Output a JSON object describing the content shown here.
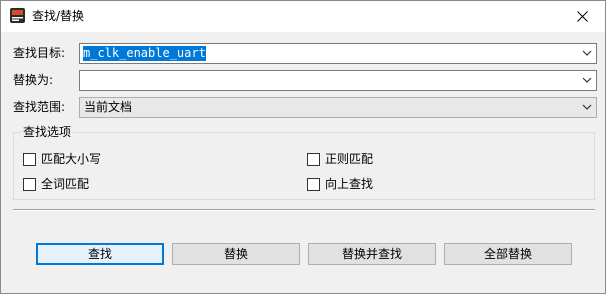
{
  "window": {
    "title": "查找/替换"
  },
  "form": {
    "find_label": "查找目标:",
    "find_value": "m_clk_enable_uart",
    "replace_label": "替换为:",
    "replace_value": "",
    "scope_label": "查找范围:",
    "scope_value": "当前文档"
  },
  "options": {
    "group_title": "查找选项",
    "match_case": {
      "label": "匹配大小写",
      "checked": false
    },
    "regex": {
      "label": "正则匹配",
      "checked": false
    },
    "whole_word": {
      "label": "全词匹配",
      "checked": false
    },
    "search_up": {
      "label": "向上查找",
      "checked": false
    }
  },
  "buttons": {
    "find": "查找",
    "replace": "替换",
    "replace_find": "替换并查找",
    "replace_all": "全部替换"
  },
  "colors": {
    "accent": "#0078d7",
    "dialog_bg": "#f0f0f0"
  }
}
